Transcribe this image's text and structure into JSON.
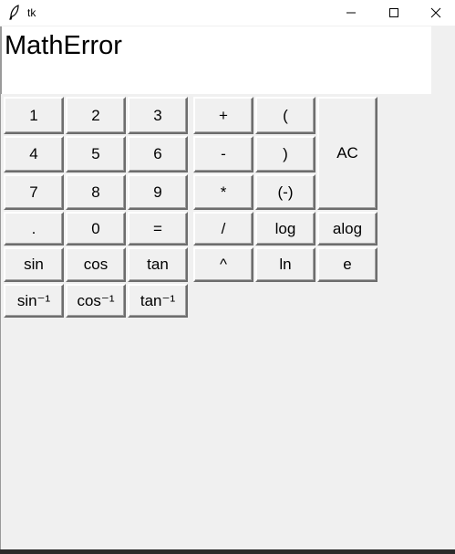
{
  "window": {
    "title": "tk",
    "controls": {
      "minimize_icon": "minimize-icon",
      "maximize_icon": "maximize-icon",
      "close_icon": "close-icon"
    }
  },
  "display": {
    "text": "MathError"
  },
  "buttons": {
    "one": "1",
    "two": "2",
    "three": "3",
    "plus": "+",
    "lparen": "(",
    "four": "4",
    "five": "5",
    "six": "6",
    "minus": "-",
    "rparen": ")",
    "ac": "AC",
    "seven": "7",
    "eight": "8",
    "nine": "9",
    "multiply": "*",
    "negate": "(-)",
    "dot": ".",
    "zero": "0",
    "equals": "=",
    "divide": "/",
    "log": "log",
    "alog": "alog",
    "sin": "sin",
    "cos": "cos",
    "tan": "tan",
    "power": "^",
    "ln": "ln",
    "e": "e",
    "asin": "sin⁻¹",
    "acos": "cos⁻¹",
    "atan": "tan⁻¹"
  },
  "colors": {
    "window_bg": "#f0f0f0",
    "display_bg": "#ffffff",
    "text": "#000000"
  }
}
